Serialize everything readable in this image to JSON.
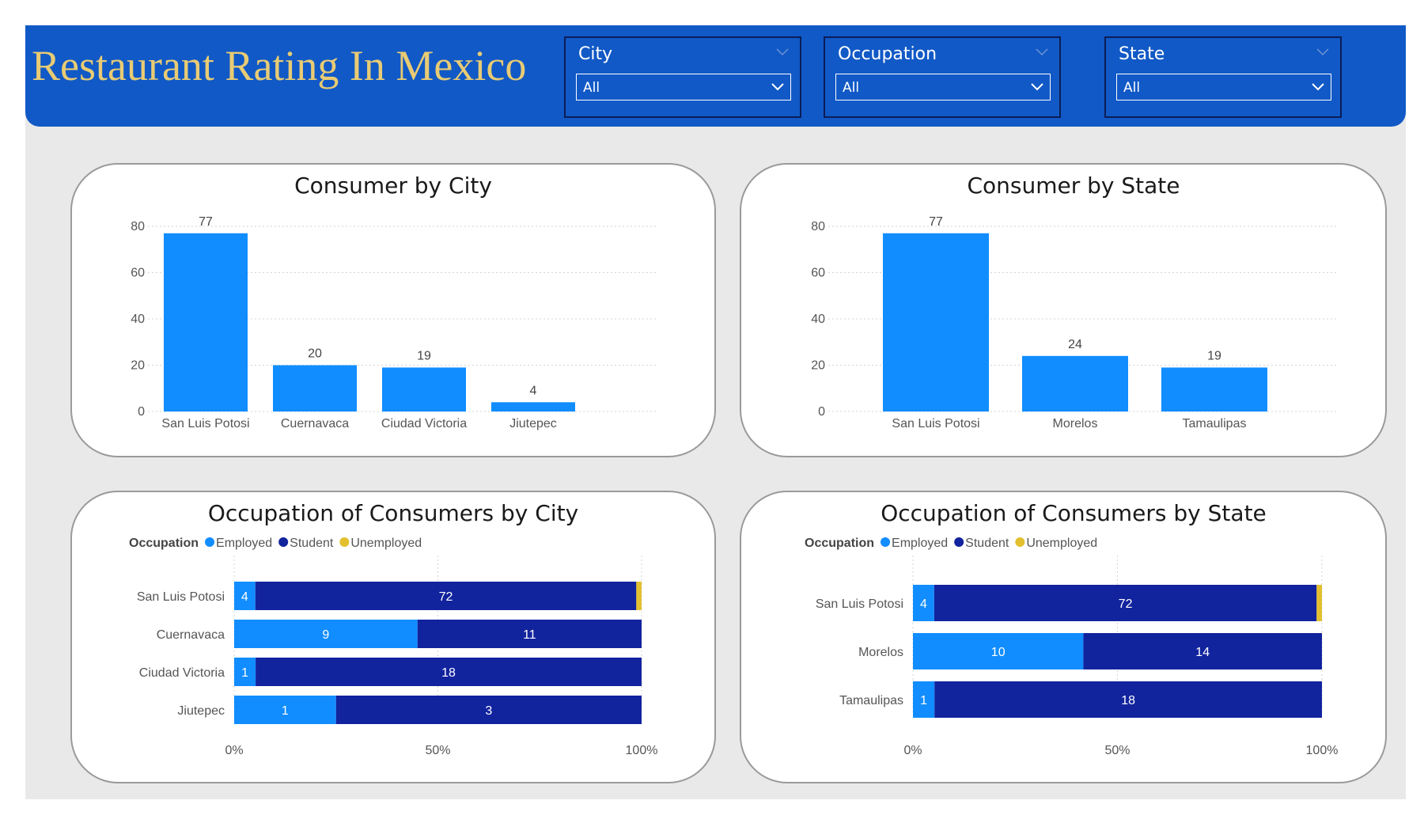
{
  "header": {
    "title": "Restaurant Rating In Mexico",
    "background": "#1159c6",
    "title_color": "#e8cb74"
  },
  "slicers": [
    {
      "label": "City",
      "value": "All"
    },
    {
      "label": "Occupation",
      "value": "All"
    },
    {
      "label": "State",
      "value": "All"
    }
  ],
  "colors": {
    "bar": "#118dff",
    "employed": "#118dff",
    "student": "#12239e",
    "unemployed": "#e3c02f"
  },
  "chart_data": [
    {
      "type": "bar",
      "title": "Consumer by City",
      "categories": [
        "San Luis Potosi",
        "Cuernavaca",
        "Ciudad Victoria",
        "Jiutepec"
      ],
      "values": [
        77,
        20,
        19,
        4
      ],
      "ylim": [
        0,
        80
      ],
      "yticks": [
        "0",
        "20",
        "40",
        "60",
        "80"
      ],
      "grid": true
    },
    {
      "type": "bar",
      "title": "Consumer by State",
      "categories": [
        "San Luis Potosi",
        "Morelos",
        "Tamaulipas"
      ],
      "values": [
        77,
        24,
        19
      ],
      "ylim": [
        0,
        80
      ],
      "yticks": [
        "0",
        "20",
        "40",
        "60",
        "80"
      ],
      "grid": true
    },
    {
      "type": "bar",
      "orientation": "horizontal",
      "stacked": "percent",
      "title": "Occupation of Consumers by City",
      "legend_title": "Occupation",
      "legend_position": "top-left",
      "categories": [
        "San Luis Potosi",
        "Cuernavaca",
        "Ciudad Victoria",
        "Jiutepec"
      ],
      "series": [
        {
          "name": "Employed",
          "values": [
            4,
            9,
            1,
            1
          ]
        },
        {
          "name": "Student",
          "values": [
            72,
            11,
            18,
            3
          ]
        },
        {
          "name": "Unemployed",
          "values": [
            1,
            0,
            0,
            0
          ]
        }
      ],
      "xticks": [
        "0%",
        "50%",
        "100%"
      ],
      "grid": true
    },
    {
      "type": "bar",
      "orientation": "horizontal",
      "stacked": "percent",
      "title": "Occupation of Consumers by State",
      "legend_title": "Occupation",
      "legend_position": "top-left",
      "categories": [
        "San Luis Potosi",
        "Morelos",
        "Tamaulipas"
      ],
      "series": [
        {
          "name": "Employed",
          "values": [
            4,
            10,
            1
          ]
        },
        {
          "name": "Student",
          "values": [
            72,
            14,
            18
          ]
        },
        {
          "name": "Unemployed",
          "values": [
            1,
            0,
            0
          ]
        }
      ],
      "xticks": [
        "0%",
        "50%",
        "100%"
      ],
      "grid": true
    }
  ]
}
